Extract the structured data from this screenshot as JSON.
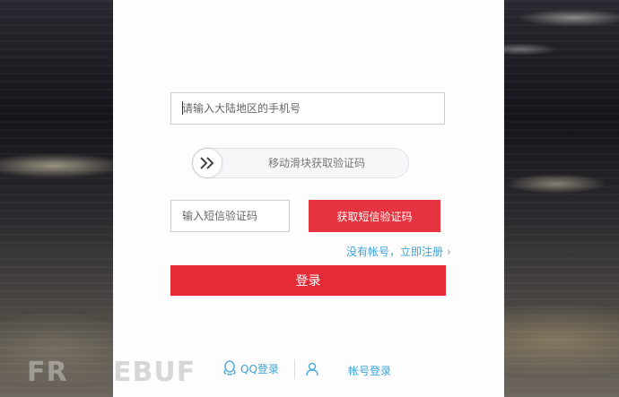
{
  "form": {
    "phone_placeholder": "请输入大陆地区的手机号",
    "slider_text": "移动滑块获取验证码",
    "slider_icon": "double-chevron-right-icon",
    "code_placeholder": "输入短信验证码",
    "sms_button": "获取短信验证码",
    "register_link": "没有帐号，立即注册",
    "register_chevron": "›",
    "login_button": "登录"
  },
  "footer": {
    "qq_login": "QQ登录",
    "account_login": "帐号登录",
    "qq_icon": "qq-icon",
    "user_icon": "user-icon"
  },
  "watermark": {
    "left": "FR",
    "right": "EBUF"
  },
  "colors": {
    "primary": "#e62b38",
    "link": "#3aa3d8",
    "panel": "#fdfdfd"
  }
}
